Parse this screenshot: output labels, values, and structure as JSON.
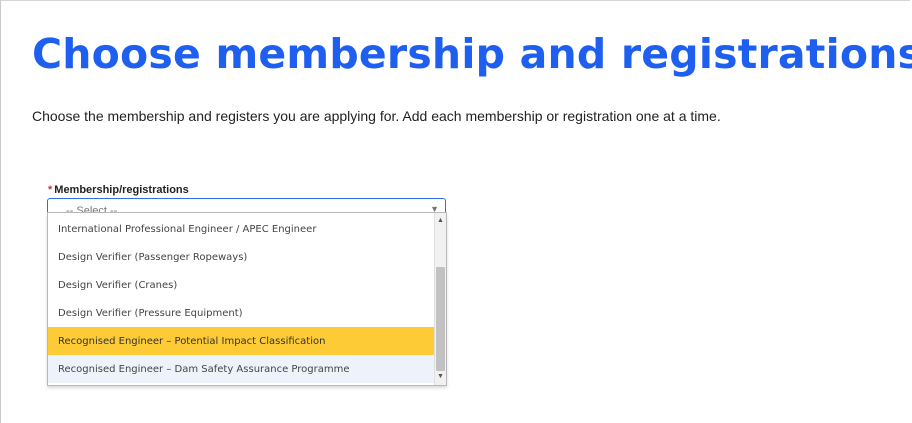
{
  "page": {
    "title": "Choose membership and registrations",
    "intro": "Choose the membership and registers you are applying for. Add each membership or registration one at a time."
  },
  "field": {
    "required_marker": "*",
    "label": "Membership/registrations",
    "value": "-- Select --",
    "arrow_icon": "chevron-down-icon"
  },
  "dropdown": {
    "options": [
      "International Professional Engineer / APEC Engineer",
      "Design Verifier (Passenger Ropeways)",
      "Design Verifier (Cranes)",
      "Design Verifier (Pressure Equipment)",
      "Recognised Engineer – Potential Impact Classification",
      "Recognised Engineer – Dam Safety Assurance Programme"
    ],
    "highlighted_index": 4,
    "hovered_index": 5,
    "highlight_color": "#fdcb35",
    "hover_color": "#eef2fb"
  },
  "colors": {
    "title": "#1f5ff0",
    "focus_border": "#2b6ee8",
    "required": "#c23934"
  }
}
